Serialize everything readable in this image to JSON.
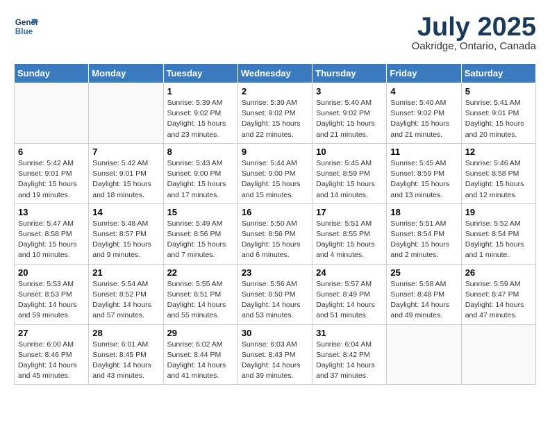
{
  "header": {
    "logo_line1": "General",
    "logo_line2": "Blue",
    "month": "July 2025",
    "location": "Oakridge, Ontario, Canada"
  },
  "days_of_week": [
    "Sunday",
    "Monday",
    "Tuesday",
    "Wednesday",
    "Thursday",
    "Friday",
    "Saturday"
  ],
  "weeks": [
    [
      {
        "day": "",
        "info": ""
      },
      {
        "day": "",
        "info": ""
      },
      {
        "day": "1",
        "info": "Sunrise: 5:39 AM\nSunset: 9:02 PM\nDaylight: 15 hours and 23 minutes."
      },
      {
        "day": "2",
        "info": "Sunrise: 5:39 AM\nSunset: 9:02 PM\nDaylight: 15 hours and 22 minutes."
      },
      {
        "day": "3",
        "info": "Sunrise: 5:40 AM\nSunset: 9:02 PM\nDaylight: 15 hours and 21 minutes."
      },
      {
        "day": "4",
        "info": "Sunrise: 5:40 AM\nSunset: 9:02 PM\nDaylight: 15 hours and 21 minutes."
      },
      {
        "day": "5",
        "info": "Sunrise: 5:41 AM\nSunset: 9:01 PM\nDaylight: 15 hours and 20 minutes."
      }
    ],
    [
      {
        "day": "6",
        "info": "Sunrise: 5:42 AM\nSunset: 9:01 PM\nDaylight: 15 hours and 19 minutes."
      },
      {
        "day": "7",
        "info": "Sunrise: 5:42 AM\nSunset: 9:01 PM\nDaylight: 15 hours and 18 minutes."
      },
      {
        "day": "8",
        "info": "Sunrise: 5:43 AM\nSunset: 9:00 PM\nDaylight: 15 hours and 17 minutes."
      },
      {
        "day": "9",
        "info": "Sunrise: 5:44 AM\nSunset: 9:00 PM\nDaylight: 15 hours and 15 minutes."
      },
      {
        "day": "10",
        "info": "Sunrise: 5:45 AM\nSunset: 8:59 PM\nDaylight: 15 hours and 14 minutes."
      },
      {
        "day": "11",
        "info": "Sunrise: 5:45 AM\nSunset: 8:59 PM\nDaylight: 15 hours and 13 minutes."
      },
      {
        "day": "12",
        "info": "Sunrise: 5:46 AM\nSunset: 8:58 PM\nDaylight: 15 hours and 12 minutes."
      }
    ],
    [
      {
        "day": "13",
        "info": "Sunrise: 5:47 AM\nSunset: 8:58 PM\nDaylight: 15 hours and 10 minutes."
      },
      {
        "day": "14",
        "info": "Sunrise: 5:48 AM\nSunset: 8:57 PM\nDaylight: 15 hours and 9 minutes."
      },
      {
        "day": "15",
        "info": "Sunrise: 5:49 AM\nSunset: 8:56 PM\nDaylight: 15 hours and 7 minutes."
      },
      {
        "day": "16",
        "info": "Sunrise: 5:50 AM\nSunset: 8:56 PM\nDaylight: 15 hours and 6 minutes."
      },
      {
        "day": "17",
        "info": "Sunrise: 5:51 AM\nSunset: 8:55 PM\nDaylight: 15 hours and 4 minutes."
      },
      {
        "day": "18",
        "info": "Sunrise: 5:51 AM\nSunset: 8:54 PM\nDaylight: 15 hours and 2 minutes."
      },
      {
        "day": "19",
        "info": "Sunrise: 5:52 AM\nSunset: 8:54 PM\nDaylight: 15 hours and 1 minute."
      }
    ],
    [
      {
        "day": "20",
        "info": "Sunrise: 5:53 AM\nSunset: 8:53 PM\nDaylight: 14 hours and 59 minutes."
      },
      {
        "day": "21",
        "info": "Sunrise: 5:54 AM\nSunset: 8:52 PM\nDaylight: 14 hours and 57 minutes."
      },
      {
        "day": "22",
        "info": "Sunrise: 5:55 AM\nSunset: 8:51 PM\nDaylight: 14 hours and 55 minutes."
      },
      {
        "day": "23",
        "info": "Sunrise: 5:56 AM\nSunset: 8:50 PM\nDaylight: 14 hours and 53 minutes."
      },
      {
        "day": "24",
        "info": "Sunrise: 5:57 AM\nSunset: 8:49 PM\nDaylight: 14 hours and 51 minutes."
      },
      {
        "day": "25",
        "info": "Sunrise: 5:58 AM\nSunset: 8:48 PM\nDaylight: 14 hours and 49 minutes."
      },
      {
        "day": "26",
        "info": "Sunrise: 5:59 AM\nSunset: 8:47 PM\nDaylight: 14 hours and 47 minutes."
      }
    ],
    [
      {
        "day": "27",
        "info": "Sunrise: 6:00 AM\nSunset: 8:46 PM\nDaylight: 14 hours and 45 minutes."
      },
      {
        "day": "28",
        "info": "Sunrise: 6:01 AM\nSunset: 8:45 PM\nDaylight: 14 hours and 43 minutes."
      },
      {
        "day": "29",
        "info": "Sunrise: 6:02 AM\nSunset: 8:44 PM\nDaylight: 14 hours and 41 minutes."
      },
      {
        "day": "30",
        "info": "Sunrise: 6:03 AM\nSunset: 8:43 PM\nDaylight: 14 hours and 39 minutes."
      },
      {
        "day": "31",
        "info": "Sunrise: 6:04 AM\nSunset: 8:42 PM\nDaylight: 14 hours and 37 minutes."
      },
      {
        "day": "",
        "info": ""
      },
      {
        "day": "",
        "info": ""
      }
    ]
  ]
}
